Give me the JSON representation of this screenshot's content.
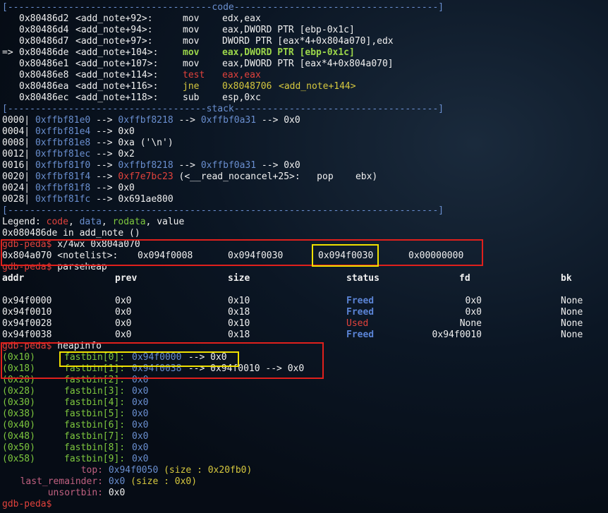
{
  "code_header": "[-------------------------------------code-------------------------------------]",
  "code_lines": [
    {
      "marker": "   ",
      "addr": "0x80486d2",
      "sym": "<add_note+92>:",
      "op": "mov",
      "args": "edx,eax"
    },
    {
      "marker": "   ",
      "addr": "0x80486d4",
      "sym": "<add_note+94>:",
      "op": "mov",
      "args": "eax,DWORD PTR [ebp-0x1c]"
    },
    {
      "marker": "   ",
      "addr": "0x80486d7",
      "sym": "<add_note+97>:",
      "op": "mov",
      "args": "DWORD PTR [eax*4+0x804a070],edx"
    },
    {
      "marker": "=> ",
      "addr": "0x80486de",
      "sym": "<add_note+104>:",
      "op": "mov",
      "args": "eax,DWORD PTR [ebp-0x1c]"
    },
    {
      "marker": "   ",
      "addr": "0x80486e1",
      "sym": "<add_note+107>:",
      "op": "mov",
      "args": "eax,DWORD PTR [eax*4+0x804a070]"
    },
    {
      "marker": "   ",
      "addr": "0x80486e8",
      "sym": "<add_note+114>:",
      "op": "test",
      "args": "eax,eax"
    },
    {
      "marker": "   ",
      "addr": "0x80486ea",
      "sym": "<add_note+116>:",
      "op": "jne",
      "args": "0x8048706",
      "target": "<add_note+144>"
    },
    {
      "marker": "   ",
      "addr": "0x80486ec",
      "sym": "<add_note+118>:",
      "op": "sub",
      "args": "esp,0xc"
    }
  ],
  "stack_header": "[------------------------------------stack-------------------------------------]",
  "stack_lines": [
    {
      "off": "0000|",
      "addr": "0xffbf81e0",
      "rest": [
        " --> ",
        "0xffbf8218",
        " --> ",
        "0xffbf0a31",
        " --> 0x0"
      ]
    },
    {
      "off": "0004|",
      "addr": "0xffbf81e4",
      "rest": [
        " --> 0x0"
      ]
    },
    {
      "off": "0008|",
      "addr": "0xffbf81e8",
      "rest": [
        " --> 0xa ('\\n')"
      ]
    },
    {
      "off": "0012|",
      "addr": "0xffbf81ec",
      "rest": [
        " --> 0x2"
      ]
    },
    {
      "off": "0016|",
      "addr": "0xffbf81f0",
      "rest": [
        " --> ",
        "0xffbf8218",
        " --> ",
        "0xffbf0a31",
        " --> 0x0"
      ]
    },
    {
      "off": "0020|",
      "addr": "0xffbf81f4",
      "rest": [
        " --> ",
        "0xf7e7bc23",
        " (<__read_nocancel+25>:   pop    ebx)"
      ]
    },
    {
      "off": "0024|",
      "addr": "0xffbf81f8",
      "rest": [
        " --> 0x0"
      ]
    },
    {
      "off": "0028|",
      "addr": "0xffbf81fc",
      "rest": [
        " --> 0x691ae800"
      ]
    }
  ],
  "footer_sep": "[------------------------------------------------------------------------------]",
  "legend": {
    "prefix": "Legend: ",
    "code": "code",
    "data": "data",
    "rodata": "rodata",
    "value": "value",
    "sep": ", "
  },
  "location": "0x080486de in add_note ()",
  "prompt": "gdb-peda$",
  "cmd1": " x/4wx 0x804a070",
  "mem": {
    "addr": "0x804a070 <notelist>:",
    "w0": "0x094f0008",
    "w1": "0x094f0030",
    "w2": "0x094f0030",
    "w3": "0x00000000"
  },
  "cmd2": " parseheap",
  "heap_headers": {
    "addr": "addr",
    "prev": "prev",
    "size": "size",
    "status": "status",
    "fd": "fd",
    "bk": "bk"
  },
  "heap_rows": [
    {
      "addr": "0x94f0000",
      "prev": "0x0",
      "size": "0x10",
      "status": "Freed",
      "fd": "0x0",
      "bk": "None"
    },
    {
      "addr": "0x94f0010",
      "prev": "0x0",
      "size": "0x18",
      "status": "Freed",
      "fd": "0x0",
      "bk": "None"
    },
    {
      "addr": "0x94f0028",
      "prev": "0x0",
      "size": "0x10",
      "status": "Used",
      "fd": "None",
      "bk": "None"
    },
    {
      "addr": "0x94f0038",
      "prev": "0x0",
      "size": "0x18",
      "status": "Freed",
      "fd": "0x94f0010",
      "bk": "None"
    }
  ],
  "cmd3": " heapinfo",
  "fastbins": [
    {
      "sz": "(0x10)",
      "name": "fastbin[0]:",
      "val": "0x94f0000",
      "tail": " --> 0x0"
    },
    {
      "sz": "(0x18)",
      "name": "fastbin[1]:",
      "val": "0x94f0038",
      "tail": " --> 0x94f0010 --> 0x0"
    },
    {
      "sz": "(0x20)",
      "name": "fastbin[2]:",
      "val": "0x0",
      "tail": ""
    },
    {
      "sz": "(0x28)",
      "name": "fastbin[3]:",
      "val": "0x0",
      "tail": ""
    },
    {
      "sz": "(0x30)",
      "name": "fastbin[4]:",
      "val": "0x0",
      "tail": ""
    },
    {
      "sz": "(0x38)",
      "name": "fastbin[5]:",
      "val": "0x0",
      "tail": ""
    },
    {
      "sz": "(0x40)",
      "name": "fastbin[6]:",
      "val": "0x0",
      "tail": ""
    },
    {
      "sz": "(0x48)",
      "name": "fastbin[7]:",
      "val": "0x0",
      "tail": ""
    },
    {
      "sz": "(0x50)",
      "name": "fastbin[8]:",
      "val": "0x0",
      "tail": ""
    },
    {
      "sz": "(0x58)",
      "name": "fastbin[9]:",
      "val": "0x0",
      "tail": ""
    }
  ],
  "top": {
    "label": "top:",
    "val": "0x94f0050",
    "tail": " (size : 0x20fb0)"
  },
  "last_remainder": {
    "label": "last_remainder:",
    "val": "0x0",
    "tail": " (size : 0x0)"
  },
  "unsortbin": {
    "label": "unsortbin:",
    "val": "0x0"
  },
  "colors": {
    "highlight_red": "#e0201c",
    "highlight_yellow": "#f0e000"
  }
}
